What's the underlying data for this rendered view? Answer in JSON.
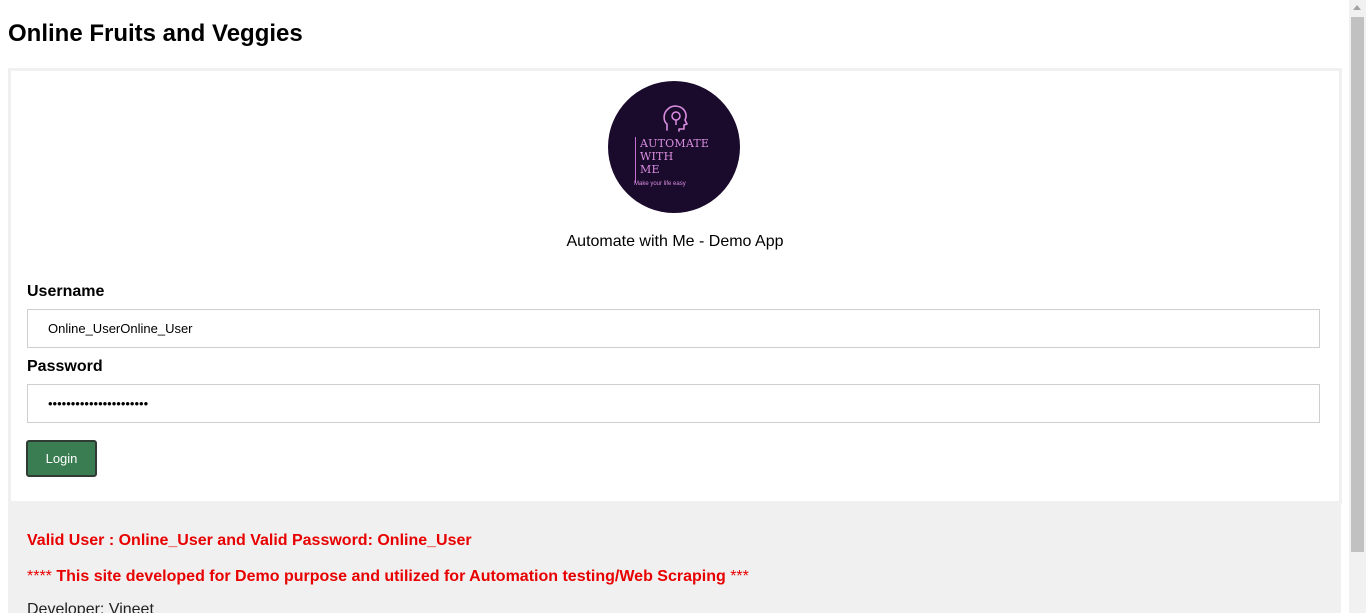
{
  "header": {
    "title": "Online Fruits and Veggies"
  },
  "logo": {
    "line1": "AUTOMATE",
    "line2": "WITH",
    "line3": "ME",
    "tagline": "Make your life easy",
    "icon": "head-gear-icon",
    "background_color": "#1a0a2b",
    "text_color": "#d98ee0"
  },
  "app_caption": "Automate with Me - Demo App",
  "form": {
    "username_label": "Username",
    "username_value": "Online_UserOnline_User",
    "password_label": "Password",
    "password_value": "••••••••••••••••••••••",
    "login_label": "Login",
    "button_color": "#3a7d52"
  },
  "footer": {
    "valid_credentials": "Valid User : Online_User and Valid Password: Online_User",
    "demo_stars_left": "****",
    "demo_note": " This site developed for Demo purpose and utilized for Automation testing/Web Scraping ",
    "demo_stars_right": "***",
    "developer": "Developer: Vineet",
    "text_color": "#e80000"
  }
}
